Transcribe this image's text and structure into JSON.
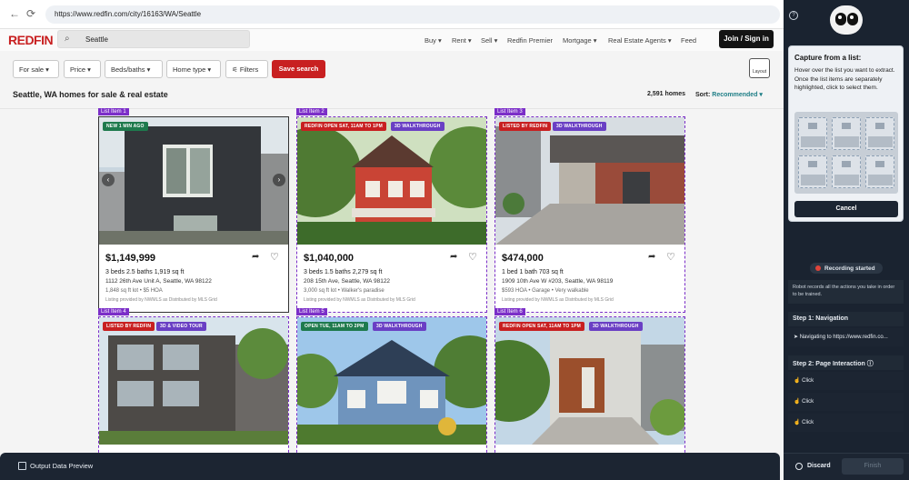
{
  "browser": {
    "url": "https://www.redfin.com/city/16163/WA/Seattle",
    "back_icon": "arrow-left",
    "reload_icon": "reload"
  },
  "header": {
    "logo": "REDFIN",
    "search_value": "Seattle",
    "nav": [
      "Buy ▾",
      "Rent ▾",
      "Sell ▾",
      "Redfin Premier",
      "Mortgage ▾",
      "Real Estate Agents ▾",
      "Feed"
    ],
    "join_label": "Join / Sign in"
  },
  "filters": {
    "for_sale": "For sale ▾",
    "price": "Price ▾",
    "beds_baths": "Beds/baths ▾",
    "home_type": "Home type ▾",
    "filters_label": "Filters",
    "save_search": "Save search",
    "layout_label": "Layout"
  },
  "results": {
    "title": "Seattle, WA homes for sale & real estate",
    "count": "2,591 homes",
    "sort_label": "Sort:",
    "sort_value": "Recommended ▾"
  },
  "listings": [
    {
      "tag": "List Item 1",
      "badges": [
        "NEW 1 MIN AGO"
      ],
      "price": "$1,149,999",
      "spec": "3 beds    2.5 baths    1,919 sq ft",
      "address": "1112 26th Ave Unit A, Seattle, WA 98122",
      "extra": "1,848 sq ft lot • $5 HOA",
      "provider": "Listing provided by NWMLS as Distributed by MLS Grid"
    },
    {
      "tag": "List Item 2",
      "badges": [
        "REDFIN OPEN SAT, 11AM TO 1PM",
        "3D WALKTHROUGH"
      ],
      "price": "$1,040,000",
      "spec": "3 beds    1.5 baths    2,279 sq ft",
      "address": "208 15th Ave, Seattle, WA 98122",
      "extra": "3,000 sq ft lot • Walker's paradise",
      "provider": "Listing provided by NWMLS as Distributed by MLS Grid"
    },
    {
      "tag": "List Item 3",
      "badges": [
        "LISTED BY REDFIN",
        "3D WALKTHROUGH"
      ],
      "price": "$474,000",
      "spec": "1 bed    1 bath    703 sq ft",
      "address": "1909 10th Ave W #203, Seattle, WA 98119",
      "extra": "$593 HOA • Garage • Very walkable",
      "provider": "Listing provided by NWMLS as Distributed by MLS Grid"
    },
    {
      "tag": "List Item 4",
      "badges": [
        "LISTED BY REDFIN",
        "3D & VIDEO TOUR"
      ]
    },
    {
      "tag": "List Item 5",
      "badges": [
        "OPEN TUE, 11AM TO 2PM",
        "3D WALKTHROUGH"
      ]
    },
    {
      "tag": "List Item 6",
      "badges": [
        "REDFIN OPEN SAT, 11AM TO 1PM",
        "3D WALKTHROUGH"
      ]
    }
  ],
  "colors": {
    "brand": "#c82021",
    "purple": "#7b2ec8",
    "green": "#1f7a4d",
    "sort": "#1e7e86"
  },
  "panel_bottom": {
    "label": "Output Data Preview"
  },
  "sidebar": {
    "capture_title": "Capture from a list:",
    "capture_desc": "Hover over the list you want to extract. Once the list items are separately highlighted, click to select them.",
    "cancel": "Cancel",
    "recording": "Recording started",
    "record_desc": "Robot records all the actions you take in order to be trained.",
    "step1": "Step 1: Navigation",
    "step1_row": "Navigating to https://www.redfin.co...",
    "step2": "Step 2: Page Interaction",
    "clicks": [
      "Click",
      "Click",
      "Click"
    ],
    "discard": "Discard",
    "finish": "Finish"
  }
}
